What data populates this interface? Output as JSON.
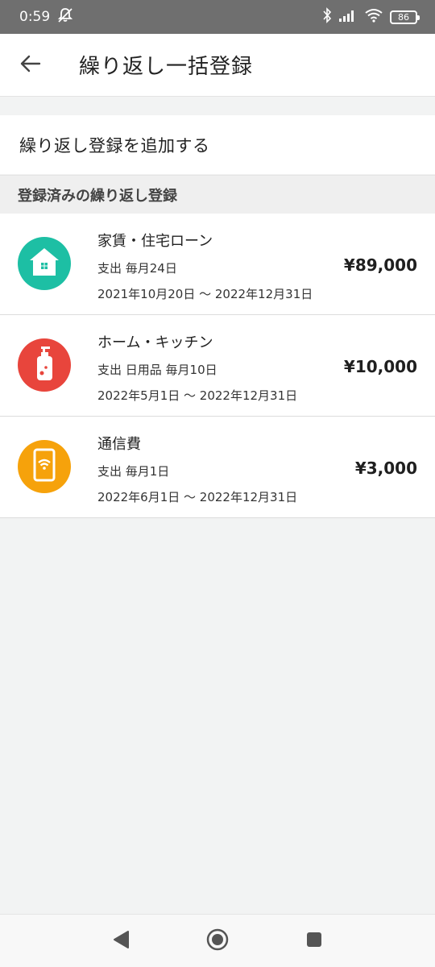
{
  "status": {
    "time": "0:59",
    "battery": "86"
  },
  "appbar": {
    "title": "繰り返し一括登録"
  },
  "add": {
    "label": "繰り返し登録を追加する"
  },
  "section": {
    "label": "登録済みの繰り返し登録"
  },
  "items": [
    {
      "name": "家賃・住宅ローン",
      "sub": "支出 毎月24日",
      "period": "2021年10月20日 〜 2022年12月31日",
      "amount": "¥89,000",
      "icon": "house-icon",
      "color": "#1dbfa4"
    },
    {
      "name": "ホーム・キッチン",
      "sub": "支出 日用品 毎月10日",
      "period": "2022年5月1日 〜 2022年12月31日",
      "amount": "¥10,000",
      "icon": "soap-bottle-icon",
      "color": "#e8453c"
    },
    {
      "name": "通信費",
      "sub": "支出 毎月1日",
      "period": "2022年6月1日 〜 2022年12月31日",
      "amount": "¥3,000",
      "icon": "smartphone-wifi-icon",
      "color": "#f6a20b"
    }
  ]
}
